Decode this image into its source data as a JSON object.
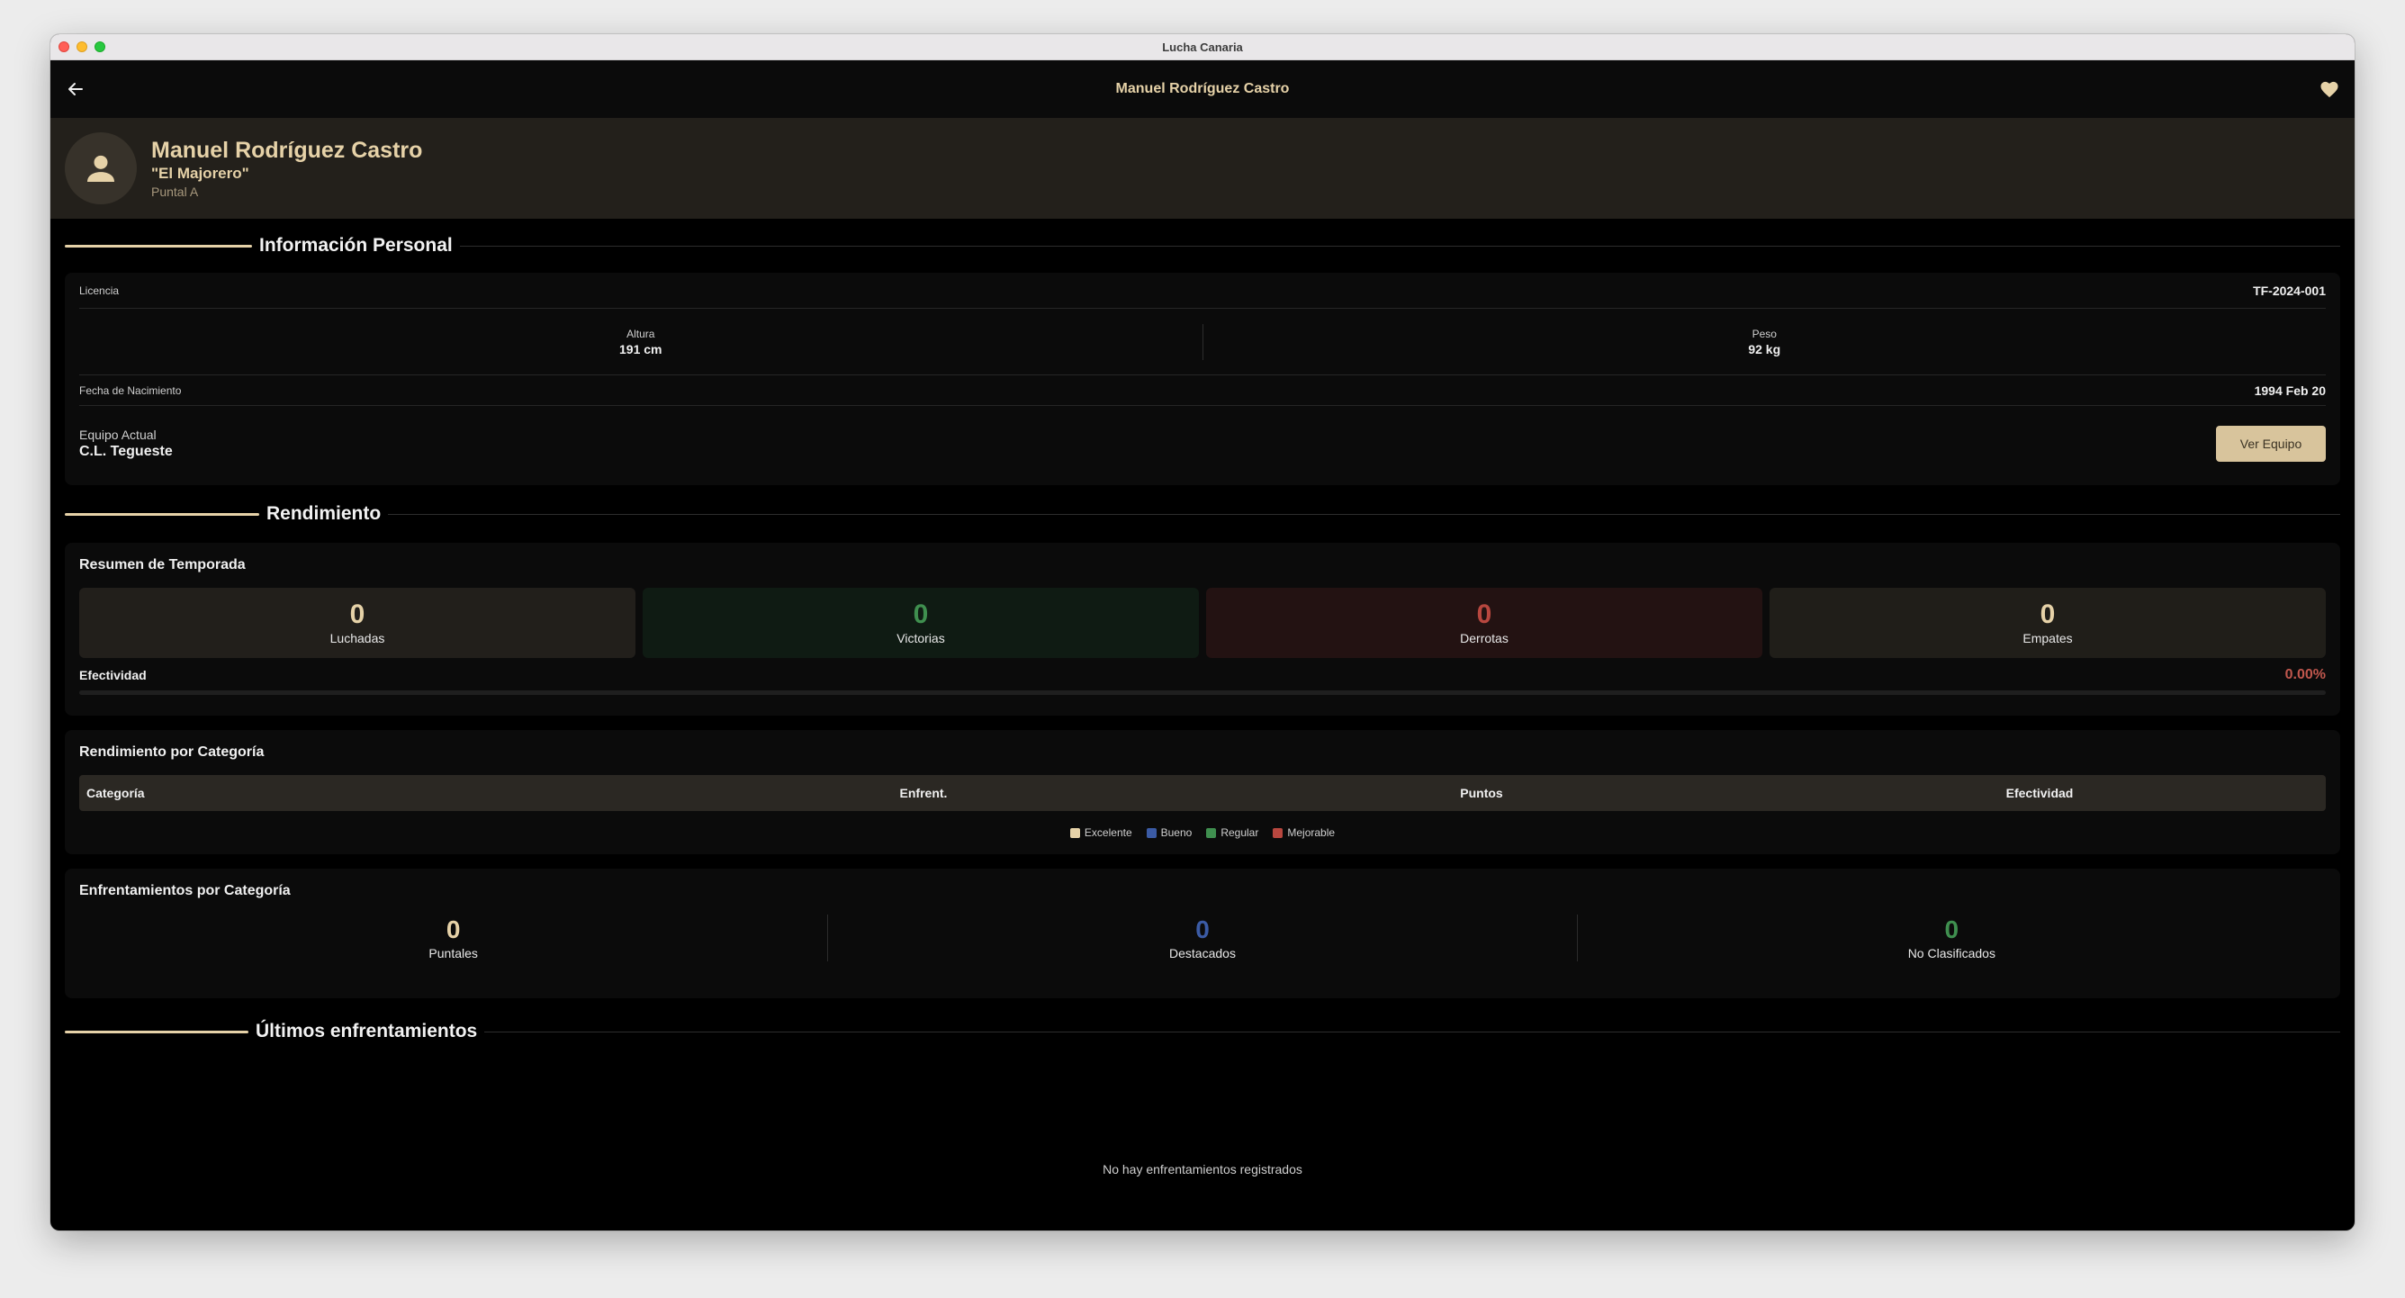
{
  "window": {
    "title": "Lucha Canaria"
  },
  "appbar": {
    "title": "Manuel Rodríguez Castro",
    "back_icon": "arrow-left",
    "favorite_icon": "heart"
  },
  "profile": {
    "name": "Manuel Rodríguez Castro",
    "nickname": "\"El Majorero\"",
    "position": "Puntal A",
    "avatar_icon": "person"
  },
  "personal": {
    "section_title": "Información Personal",
    "license": {
      "label": "Licencia",
      "value": "TF-2024-001"
    },
    "height": {
      "label": "Altura",
      "value": "191 cm"
    },
    "weight": {
      "label": "Peso",
      "value": "92 kg"
    },
    "birthdate": {
      "label": "Fecha de Nacimiento",
      "value": "1994 Feb 20"
    },
    "team": {
      "label": "Equipo Actual",
      "value": "C.L. Tegueste",
      "button": "Ver Equipo"
    }
  },
  "performance": {
    "section_title": "Rendimiento",
    "summary_title": "Resumen de Temporada",
    "stats": [
      {
        "value": "0",
        "label": "Luchadas",
        "color": "#e6d2a8",
        "bg": "#221f1b"
      },
      {
        "value": "0",
        "label": "Victorias",
        "color": "#3f8f4f",
        "bg": "#0f1b13"
      },
      {
        "value": "0",
        "label": "Derrotas",
        "color": "#b8473f",
        "bg": "#231212"
      },
      {
        "value": "0",
        "label": "Empates",
        "color": "#e6d2a8",
        "bg": "#201e19"
      }
    ],
    "effectiveness": {
      "label": "Efectividad",
      "value": "0.00%",
      "fraction": 0.0
    },
    "by_category": {
      "title": "Rendimiento por Categoría",
      "columns": [
        "Categoría",
        "Enfrent.",
        "Puntos",
        "Efectividad"
      ],
      "legend": [
        {
          "label": "Excelente",
          "color": "#e6d2a8"
        },
        {
          "label": "Bueno",
          "color": "#3b5ba5"
        },
        {
          "label": "Regular",
          "color": "#3f8f4f"
        },
        {
          "label": "Mejorable",
          "color": "#b8473f"
        }
      ]
    },
    "matchups": {
      "title": "Enfrentamientos por Categoría",
      "items": [
        {
          "value": "0",
          "label": "Puntales",
          "color": "#e6d2a8"
        },
        {
          "value": "0",
          "label": "Destacados",
          "color": "#3b5ba5"
        },
        {
          "value": "0",
          "label": "No Clasificados",
          "color": "#3f8f4f"
        }
      ]
    }
  },
  "recent": {
    "section_title": "Últimos enfrentamientos",
    "empty_message": "No hay enfrentamientos registrados"
  }
}
